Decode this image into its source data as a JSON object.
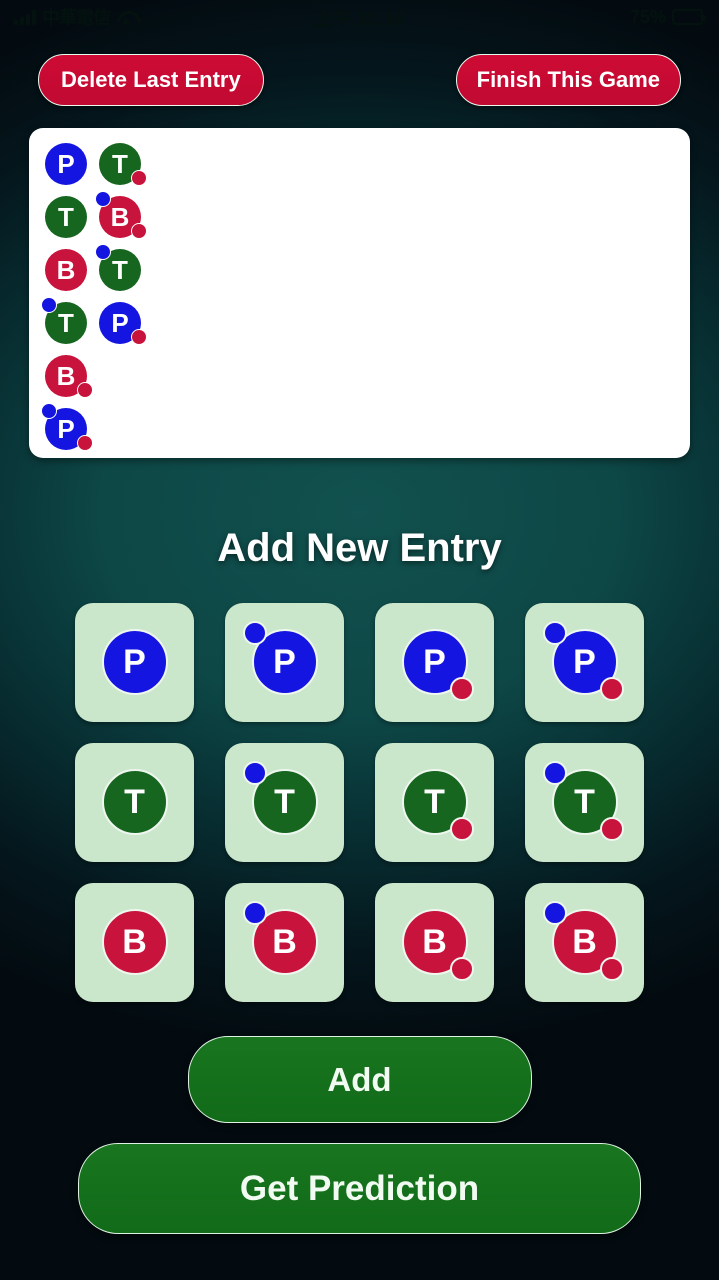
{
  "status_bar": {
    "carrier": "中華電信",
    "time": "上午 11:18",
    "battery_percent": "75%",
    "signal_icon": "cellular-signal-icon",
    "wifi_icon": "wifi-icon",
    "battery_icon": "battery-icon",
    "battery_level": 75
  },
  "toolbar": {
    "delete_label": "Delete Last Entry",
    "finish_label": "Finish This Game"
  },
  "entries_list": {
    "rows": [
      [
        {
          "letter": "P",
          "color": "#1515e2",
          "blue_dot": false,
          "red_dot": false
        },
        {
          "letter": "T",
          "color": "#16661f",
          "blue_dot": false,
          "red_dot": true
        }
      ],
      [
        {
          "letter": "T",
          "color": "#16661f",
          "blue_dot": false,
          "red_dot": false
        },
        {
          "letter": "B",
          "color": "#c8133c",
          "blue_dot": true,
          "red_dot": true
        }
      ],
      [
        {
          "letter": "B",
          "color": "#c8133c",
          "blue_dot": false,
          "red_dot": false
        },
        {
          "letter": "T",
          "color": "#16661f",
          "blue_dot": true,
          "red_dot": false
        }
      ],
      [
        {
          "letter": "T",
          "color": "#16661f",
          "blue_dot": true,
          "red_dot": false
        },
        {
          "letter": "P",
          "color": "#1515e2",
          "blue_dot": false,
          "red_dot": true
        }
      ],
      [
        {
          "letter": "B",
          "color": "#c8133c",
          "blue_dot": false,
          "red_dot": true
        }
      ],
      [
        {
          "letter": "P",
          "color": "#1515e2",
          "blue_dot": true,
          "red_dot": true
        }
      ]
    ]
  },
  "add_entry": {
    "title": "Add New Entry",
    "options": [
      {
        "letter": "P",
        "color": "#1515e2",
        "blue_dot": false,
        "red_dot": false
      },
      {
        "letter": "P",
        "color": "#1515e2",
        "blue_dot": true,
        "red_dot": false
      },
      {
        "letter": "P",
        "color": "#1515e2",
        "blue_dot": false,
        "red_dot": true
      },
      {
        "letter": "P",
        "color": "#1515e2",
        "blue_dot": true,
        "red_dot": true
      },
      {
        "letter": "T",
        "color": "#16661f",
        "blue_dot": false,
        "red_dot": false
      },
      {
        "letter": "T",
        "color": "#16661f",
        "blue_dot": true,
        "red_dot": false
      },
      {
        "letter": "T",
        "color": "#16661f",
        "blue_dot": false,
        "red_dot": true
      },
      {
        "letter": "T",
        "color": "#16661f",
        "blue_dot": true,
        "red_dot": true
      },
      {
        "letter": "B",
        "color": "#c8133c",
        "blue_dot": false,
        "red_dot": false
      },
      {
        "letter": "B",
        "color": "#c8133c",
        "blue_dot": true,
        "red_dot": false
      },
      {
        "letter": "B",
        "color": "#c8133c",
        "blue_dot": false,
        "red_dot": true
      },
      {
        "letter": "B",
        "color": "#c8133c",
        "blue_dot": true,
        "red_dot": true
      }
    ]
  },
  "actions": {
    "add_label": "Add",
    "prediction_label": "Get Prediction"
  },
  "colors": {
    "player_blue": "#1515e2",
    "tie_green": "#16661f",
    "banker_red": "#c8133c",
    "danger_button": "#c80a31",
    "primary_button": "#136e1b",
    "tile_background": "#cbe7cb",
    "card_background": "#ffffff"
  }
}
